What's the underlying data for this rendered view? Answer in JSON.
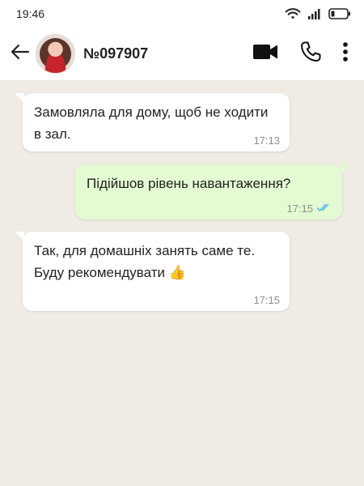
{
  "status_bar": {
    "time": "19:46"
  },
  "header": {
    "contact_name": "№097907",
    "icons": [
      "back-arrow-icon",
      "video-call-icon",
      "phone-icon",
      "more-vertical-icon"
    ]
  },
  "messages": [
    {
      "direction": "incoming",
      "text": "Замовляла для дому, щоб не ходити в зал.",
      "time": "17:13"
    },
    {
      "direction": "outgoing",
      "text": "Підійшов рівень навантаження?",
      "time": "17:15",
      "status": "read"
    },
    {
      "direction": "incoming",
      "text": "Так, для домашніх занять саме те. Буду рекомендувати 👍",
      "time": "17:15"
    }
  ],
  "colors": {
    "chat_background": "#f0ebe4",
    "outgoing_bubble": "#e2fbd2",
    "incoming_bubble": "#ffffff",
    "read_ticks": "#4fb3e8"
  }
}
